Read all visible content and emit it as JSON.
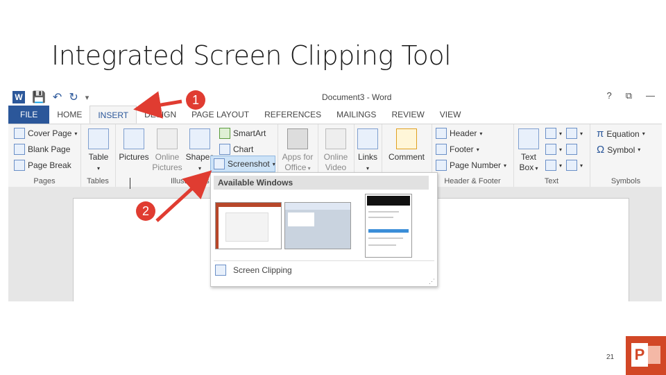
{
  "slide": {
    "title": "Integrated Screen Clipping Tool",
    "page_number": "21",
    "callouts": [
      "1",
      "2"
    ]
  },
  "window": {
    "title": "Document3 - Word",
    "controls": [
      "?",
      "⧉",
      "—"
    ]
  },
  "ribbon": {
    "tabs": [
      "FILE",
      "HOME",
      "INSERT",
      "DESIGN",
      "PAGE LAYOUT",
      "REFERENCES",
      "MAILINGS",
      "REVIEW",
      "VIEW"
    ],
    "active_tab": "INSERT",
    "pages": {
      "items": [
        "Cover Page",
        "Blank Page",
        "Page Break"
      ],
      "label": "Pages"
    },
    "tables": {
      "button": "Table",
      "label": "Tables"
    },
    "illustrations": {
      "pictures": "Pictures",
      "online_pictures_1": "Online",
      "online_pictures_2": "Pictures",
      "shapes": "Shapes",
      "smartart": "SmartArt",
      "chart": "Chart",
      "screenshot": "Screenshot",
      "label": "Illustrations"
    },
    "apps": {
      "line1": "Apps for",
      "line2": "Office"
    },
    "media": {
      "line1": "Online",
      "line2": "Video"
    },
    "links": {
      "button": "Links"
    },
    "comments": {
      "button": "Comment"
    },
    "header_footer": {
      "header": "Header",
      "footer": "Footer",
      "page_number": "Page Number",
      "label": "Header & Footer"
    },
    "text": {
      "line1": "Text",
      "line2": "Box",
      "label": "Text"
    },
    "symbols": {
      "equation": "Equation",
      "symbol": "Symbol",
      "label": "Symbols"
    }
  },
  "dropdown": {
    "heading": "Available Windows",
    "screen_clipping": "Screen Clipping"
  },
  "colors": {
    "word_blue": "#2b579a",
    "callout_red": "#e03c31",
    "ppt_orange": "#d24726"
  }
}
